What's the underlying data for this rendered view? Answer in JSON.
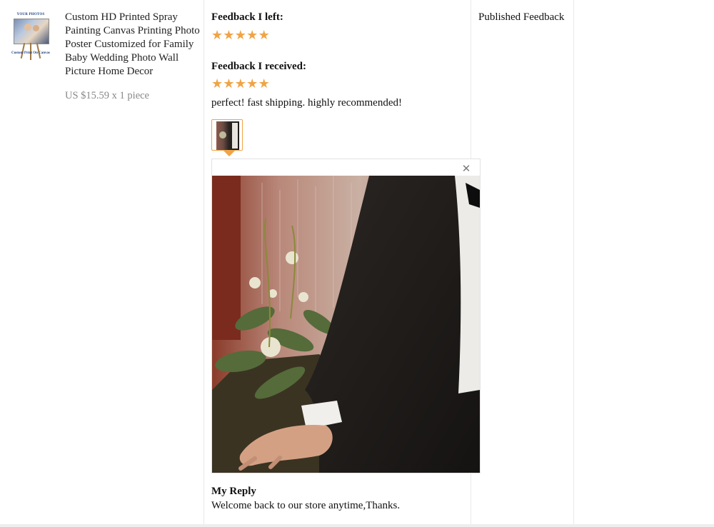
{
  "product": {
    "thumbnail_top_text": "YOUR PHOTOS",
    "thumbnail_bottom_text": "Custom Print On Canvas",
    "title": "Custom HD Printed Spray Painting Canvas Printing Photo Poster Customized for Family Baby Wedding Photo Wall Picture Home Decor",
    "price": "US $15.59 x 1 piece"
  },
  "feedback": {
    "left_label": "Feedback I left:",
    "left_stars": 5,
    "received_label": "Feedback I received:",
    "received_stars": 5,
    "received_text": "perfect! fast shipping. highly recommended!",
    "star_icon": "star-icon",
    "star_color": "#f0a446"
  },
  "preview": {
    "close_icon": "close-icon"
  },
  "reply": {
    "label": "My Reply",
    "text": "Welcome back to our store anytime,Thanks."
  },
  "status": {
    "published_label": "Published Feedback"
  }
}
